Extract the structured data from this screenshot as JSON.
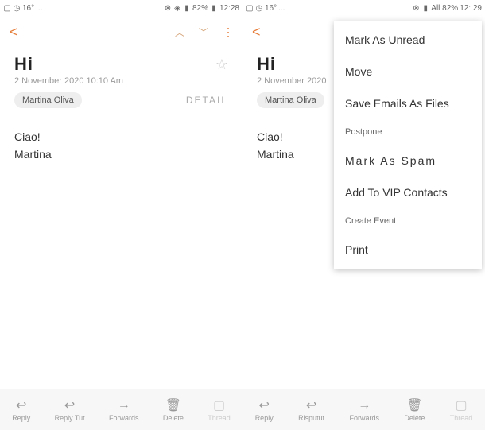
{
  "left": {
    "status": {
      "temp": "16°",
      "dots": "...",
      "battery": "82%",
      "time": "12:28"
    },
    "email": {
      "subject": "Hi",
      "date": "2 November 2020 10:10 Am",
      "sender": "Martina Oliva",
      "detail": "DETAIL",
      "greeting": "Ciao!",
      "signature": "Martina"
    }
  },
  "right": {
    "status": {
      "temp": "16°",
      "dots": "...",
      "battery": "All 82%",
      "time": "12: 29"
    },
    "email": {
      "subject": "Hi",
      "date": "2 November 2020",
      "sender": "Martina Oliva",
      "greeting": "Ciao!",
      "signature": "Martina"
    },
    "menu": {
      "unread": "Mark As Unread",
      "move": "Move",
      "save": "Save Emails As Files",
      "postpone": "Postpone",
      "spam": "Mark As Spam",
      "vip": "Add To VIP Contacts",
      "event": "Create Event",
      "print": "Print"
    }
  },
  "bottom": {
    "left": {
      "reply": "Reply",
      "replytut": "Reply Tut",
      "forwards": "Forwards",
      "delete": "Delete",
      "thread": "Thread"
    },
    "right": {
      "reply": "Reply",
      "risputut": "Risputut",
      "forwards": "Forwards",
      "delete": "Delete",
      "thread": "Thread"
    }
  }
}
